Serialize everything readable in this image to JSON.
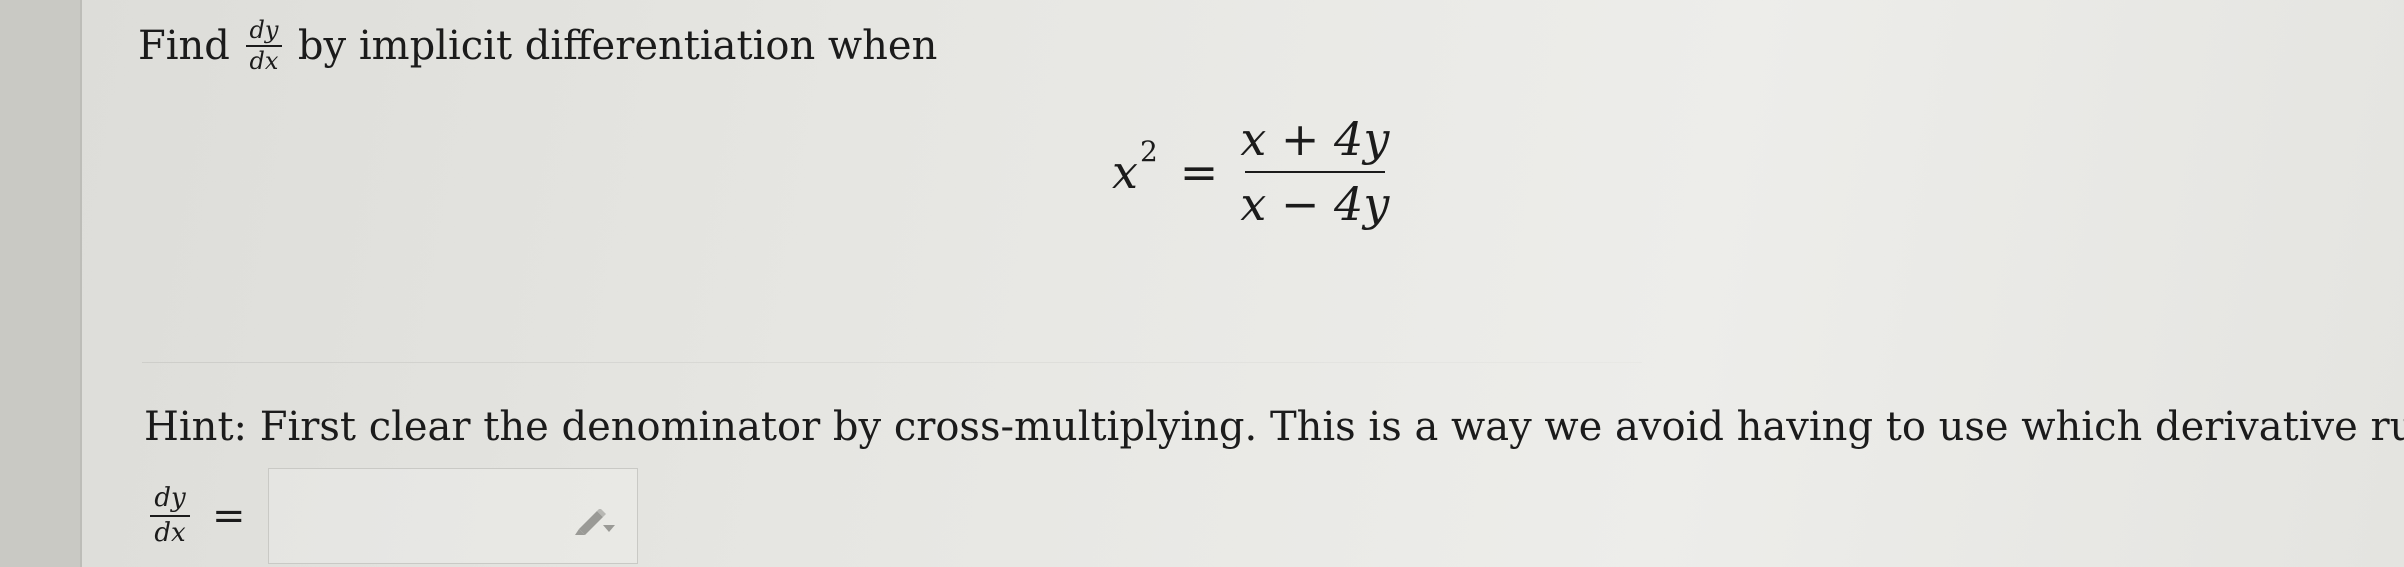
{
  "question": {
    "prefix": "Find",
    "frac_num": "dy",
    "frac_den": "dx",
    "suffix": "by implicit differentiation when"
  },
  "equation": {
    "lhs_base": "x",
    "lhs_exp": "2",
    "eq": "=",
    "rhs_num": "x + 4y",
    "rhs_den": "x − 4y"
  },
  "hint": {
    "text": "Hint: First clear the denominator by cross-multiplying. This is a way we avoid having to use which derivative rule?"
  },
  "answer": {
    "label_num": "dy",
    "label_den": "dx",
    "eq": "=",
    "value": ""
  },
  "icons": {
    "editor": "pencil-icon"
  },
  "colors": {
    "text": "#1b1b1b",
    "box_border": "#c9c9c5",
    "icon": "#9a9a96"
  }
}
